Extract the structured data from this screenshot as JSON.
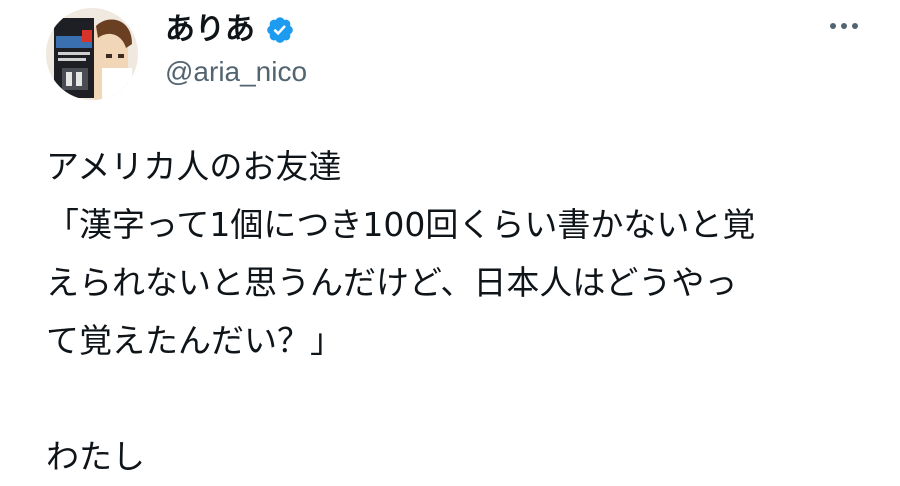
{
  "author": {
    "display_name": "ありあ",
    "handle": "@aria_nico",
    "verified": true,
    "avatar_icon": "avatar-image",
    "verified_icon": "verified-badge-icon"
  },
  "menu": {
    "more_icon": "more-options-icon"
  },
  "tweet": {
    "lines": [
      "アメリカ人のお友達",
      "「漢字って1個につき100回くらい書かないと覚",
      "えられないと思うんだけど、日本人はどうやっ",
      "て覚えたんだい？」",
      "",
      "わたし"
    ]
  },
  "colors": {
    "text": "#0f1419",
    "secondary": "#536471",
    "verified": "#1d9bf0"
  }
}
